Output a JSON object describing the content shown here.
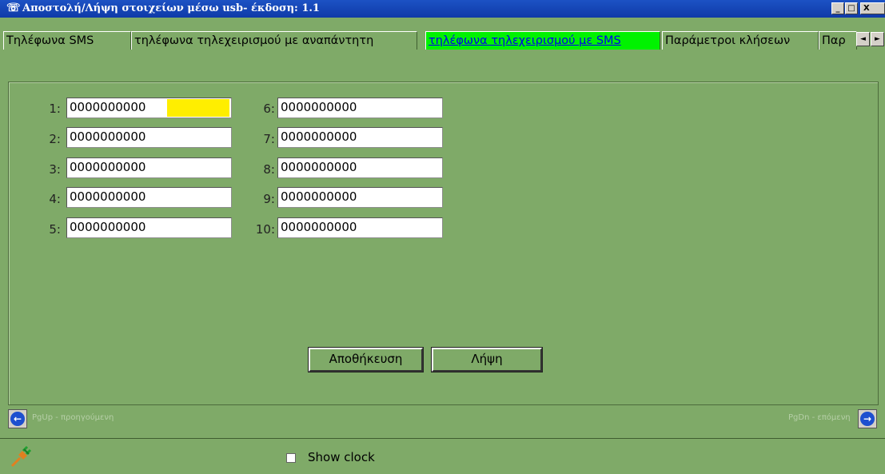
{
  "window": {
    "title": "Αποστολή/Λήψη στοιχείων μέσω usb- έκδοση: 1.1",
    "icon": "telephone-icon",
    "minimize": "_",
    "maximize": "□",
    "close": "X"
  },
  "tabs": [
    {
      "label": "Τηλέφωνα SMS",
      "active": false
    },
    {
      "label": "τηλέφωνα τηλεχειρισμού με αναπάντητη",
      "active": false
    },
    {
      "label": "τηλέφωνα τηλεχειρισμού με SMS",
      "active": true
    },
    {
      "label": "Παράμετροι κλήσεων",
      "active": false
    },
    {
      "label": "Παρ",
      "active": false
    }
  ],
  "tab_scroll": {
    "left": "◄",
    "right": "►"
  },
  "phones": {
    "left": [
      {
        "num": "1:",
        "value": "0000000000"
      },
      {
        "num": "2:",
        "value": "0000000000"
      },
      {
        "num": "3:",
        "value": "0000000000"
      },
      {
        "num": "4:",
        "value": "0000000000"
      },
      {
        "num": "5:",
        "value": "0000000000"
      }
    ],
    "right": [
      {
        "num": "6:",
        "value": "0000000000"
      },
      {
        "num": "7:",
        "value": "0000000000"
      },
      {
        "num": "8:",
        "value": "0000000000"
      },
      {
        "num": "9:",
        "value": "0000000000"
      },
      {
        "num": "10:",
        "value": "0000000000"
      }
    ]
  },
  "actions": {
    "save": "Αποθήκευση",
    "receive": "Λήψη"
  },
  "nav": {
    "prev_label": "PgUp - προηγούμενη",
    "next_label": "PgDn - επόμενη",
    "prev_icon": "arrow-left-icon",
    "next_icon": "arrow-right-icon"
  },
  "status": {
    "show_clock_label": "Show clock",
    "show_clock_checked": false,
    "connection_icon": "usb-plug-icon"
  },
  "colors": {
    "background": "#7faa68",
    "active_tab": "#00f200",
    "highlight": "#ffee00",
    "titlebar": "#1c52c4"
  }
}
